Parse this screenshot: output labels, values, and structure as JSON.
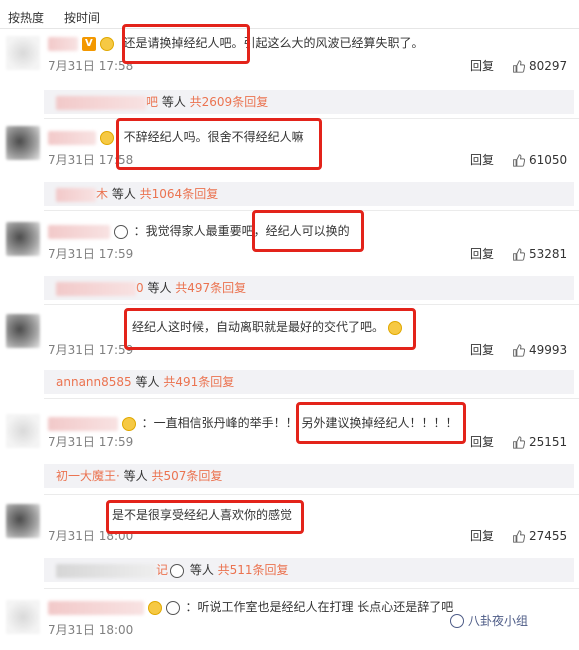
{
  "tabs": {
    "hot": "按热度",
    "time": "按时间"
  },
  "reply_label": "回复",
  "comments": [
    {
      "text": "还是请换掉经纪人吧。引起这么大的风波已经算失职了。",
      "date": "7月31日 17:58",
      "likes": "80297",
      "sub": {
        "who_suffix": "吧",
        "etc": " 等人 ",
        "count": "共2609条回复"
      }
    },
    {
      "text": "不辞经纪人吗。很舍不得经纪人嘛",
      "date": "7月31日 17:58",
      "likes": "61050",
      "sub": {
        "who_suffix": "木",
        "etc": " 等人 ",
        "count": "共1064条回复"
      }
    },
    {
      "text": "：我觉得家人最重要吧，经纪人可以换的",
      "date": "7月31日 17:59",
      "likes": "53281",
      "sub": {
        "who_suffix": "0",
        "etc": " 等人 ",
        "count": "共497条回复"
      }
    },
    {
      "text": "经纪人这时候，自动离职就是最好的交代了吧。",
      "date": "7月31日 17:59",
      "likes": "49993",
      "sub": {
        "who": "annann8585",
        "etc": " 等人 ",
        "count": "共491条回复"
      }
    },
    {
      "text": "：一直相信张丹峰的举手！！ 另外建议换掉经纪人！！！！",
      "date": "7月31日 17:59",
      "likes": "25151",
      "sub": {
        "who": "初一大魔王·",
        "etc": " 等人 ",
        "count": "共507条回复"
      }
    },
    {
      "text": "是不是很享受经纪人喜欢你的感觉",
      "date": "7月31日 18:00",
      "likes": "27455",
      "sub": {
        "who_suffix": "记",
        "etc": " 等人 ",
        "count": "共511条回复"
      }
    },
    {
      "text": "：听说工作室也是经纪人在打理 长点心还是辞了吧",
      "date": "7月31日 18:00",
      "likes": ""
    }
  ],
  "watermark": "八卦夜小组",
  "icons": {
    "thumb": "thumbs-up-icon",
    "vip": "v-badge-icon",
    "emoji": "emoji-icon",
    "panda": "panda-emoji-icon"
  },
  "colors": {
    "highlight": "#e3231a",
    "link": "#eb7350",
    "meta": "#808080"
  }
}
